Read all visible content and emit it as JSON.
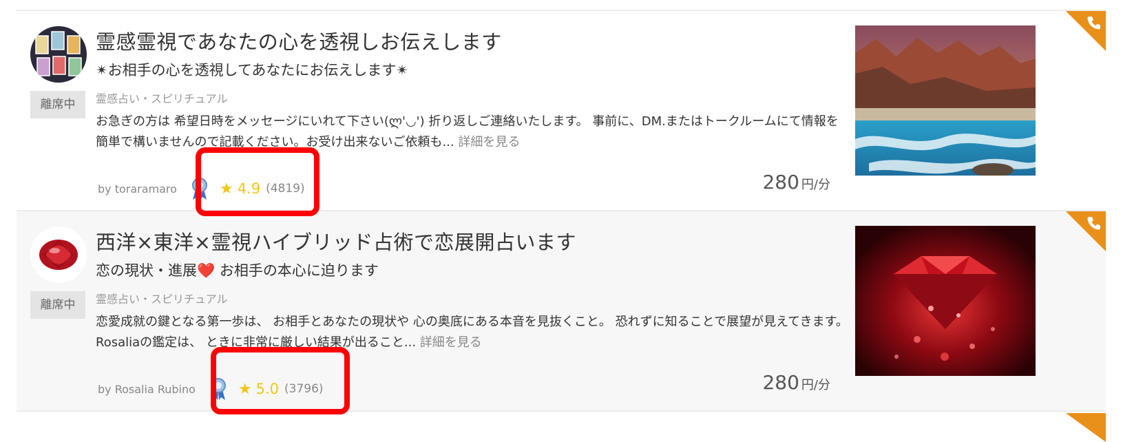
{
  "cards": [
    {
      "title": "霊感霊視であなたの心を透視しお伝えします",
      "subtitle": "✴お相手の心を透視してあなたにお伝えします✴",
      "status": "離席中",
      "category": "霊感占い・スピリチュアル",
      "description": "お急ぎの方は 希望日時をメッセージにいれて下さい(ლ'◡') 折り返しご連絡いたします。 事前に、DM.またはトークルームにて情報を簡単で構いませんので記載ください。お受け出来ないご依頼も...",
      "more": "詳細を見る",
      "by": "by toraramaro",
      "rating": "4.9",
      "count": "(4819)",
      "price": "280",
      "unit": "円/分",
      "thumb_icon": "landscape-photo",
      "avatar_icon": "tarot-cards-avatar"
    },
    {
      "title": "西洋×東洋×霊視ハイブリッド占術で恋展開占います",
      "subtitle": "恋の現状・進展❤️ お相手の本心に迫ります",
      "status": "離席中",
      "category": "霊感占い・スピリチュアル",
      "description": "恋愛成就の鍵となる第一歩は、 お相手とあなたの現状や 心の奥底にある本音を見抜くこと。 恐れずに知ることで展望が見えてきます。 Rosaliaの鑑定は、 ときに非常に厳しい結果が出ること...",
      "more": "詳細を見る",
      "by": "by Rosalia Rubino",
      "rating": "5.0",
      "count": "(3796)",
      "price": "280",
      "unit": "円/分",
      "thumb_icon": "red-gem-photo",
      "avatar_icon": "ruby-gem-avatar"
    }
  ],
  "colors": {
    "star": "#f5c518",
    "corner": "#e8901a",
    "highlight": "#ff0000",
    "status_bg": "#e4e4e4"
  }
}
